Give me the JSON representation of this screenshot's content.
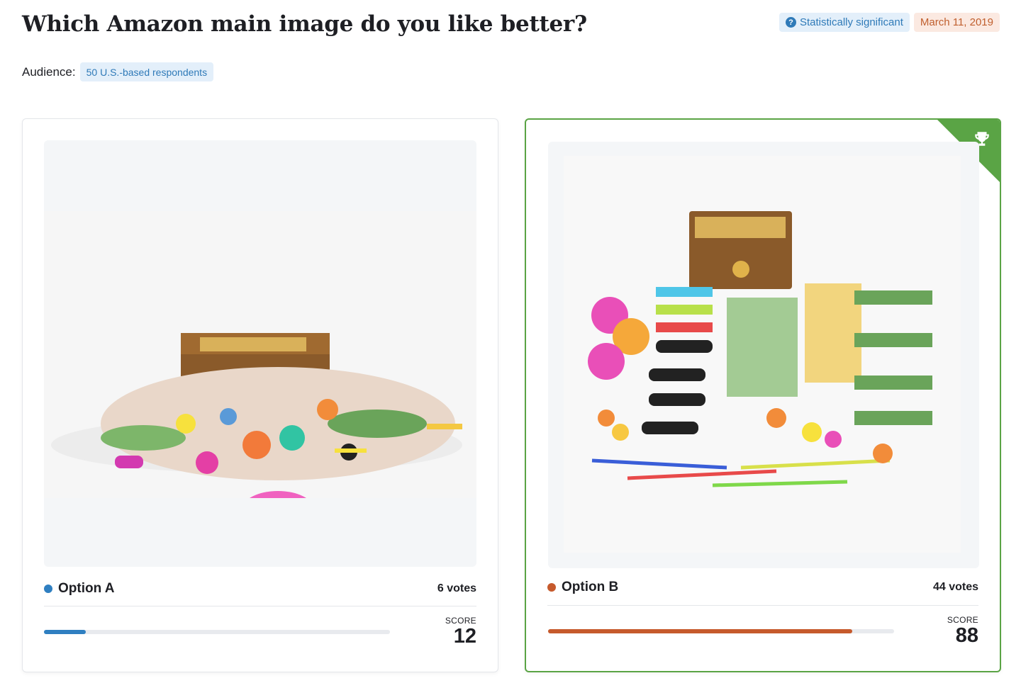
{
  "title": "Which Amazon main image do you like better?",
  "badges": {
    "significance": "Statistically significant",
    "date": "March 11, 2019"
  },
  "audience": {
    "label": "Audience:",
    "chip": "50 U.S.-based respondents"
  },
  "options": [
    {
      "name": "Option A",
      "votes": "6 votes",
      "score_label": "SCORE",
      "score": "12",
      "score_fraction": 0.12,
      "color": "#2f7fc1",
      "winner": false
    },
    {
      "name": "Option B",
      "votes": "44 votes",
      "score_label": "SCORE",
      "score": "88",
      "score_fraction": 0.88,
      "color": "#c65a2c",
      "winner": true,
      "winner_icon": "trophy-icon"
    }
  ],
  "colors": {
    "winner_border": "#5aa445",
    "badge_blue": "#2f7ab8",
    "badge_orange": "#c05f2e"
  }
}
